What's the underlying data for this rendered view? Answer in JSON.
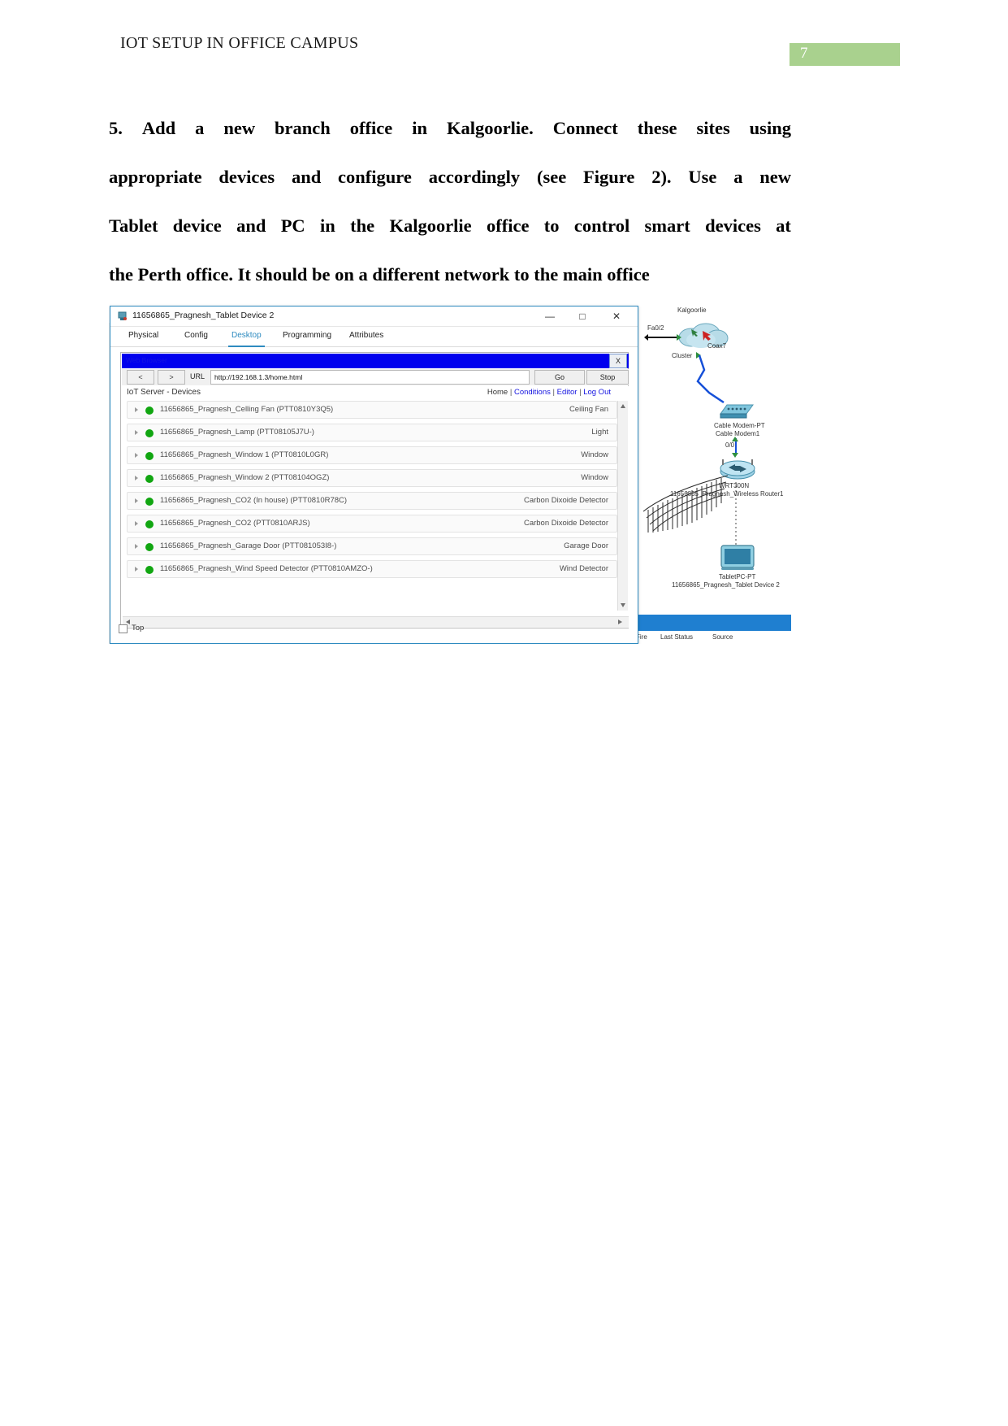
{
  "header": {
    "title": "IOT SETUP IN OFFICE CAMPUS",
    "page_number": "7",
    "page_number_bg": "#a9d18e"
  },
  "paragraph": {
    "lines": [
      [
        "5.",
        "Add",
        "a",
        "new",
        "branch",
        "office",
        "in",
        "Kalgoorlie.",
        "Connect",
        "these",
        "sites",
        "using"
      ],
      [
        "appropriate",
        "devices",
        "and",
        "configure",
        "accordingly",
        "(see",
        "Figure",
        "2).",
        "Use",
        "a",
        "new"
      ],
      [
        "Tablet",
        "device",
        "and",
        "PC",
        "in",
        "the",
        "Kalgoorlie",
        "office",
        "to",
        "control",
        "smart",
        "devices",
        "at"
      ]
    ],
    "last_line": "the Perth office.  It should be on a different network to the main office"
  },
  "tablet_window": {
    "title": "11656865_Pragnesh_Tablet Device 2",
    "icon": "packet-tracer-device-icon",
    "minimize": "—",
    "maximize": "□",
    "close": "✕",
    "tabs": [
      {
        "label": "Physical",
        "active": false
      },
      {
        "label": "Config",
        "active": false
      },
      {
        "label": "Desktop",
        "active": true
      },
      {
        "label": "Programming",
        "active": false
      },
      {
        "label": "Attributes",
        "active": false
      }
    ],
    "active_tab_color": "#2e8bc0"
  },
  "browser": {
    "title": "Web Browser",
    "title_bg": "#0000ee",
    "close_label": "X",
    "back_label": "<",
    "forward_label": ">",
    "url_label": "URL",
    "url_value": "http://192.168.1.3/home.html",
    "go_label": "Go",
    "stop_label": "Stop"
  },
  "page": {
    "heading": "IoT Server - Devices",
    "links": [
      {
        "label": "Home",
        "is_link": false
      },
      {
        "label": "Conditions",
        "is_link": true
      },
      {
        "label": "Editor",
        "is_link": true
      },
      {
        "label": "Log Out",
        "is_link": true
      }
    ],
    "link_separator": "|",
    "devices": [
      {
        "name": "11656865_Pragnesh_Celling Fan (PTT0810Y3Q5)",
        "type": "Ceiling Fan",
        "status": "on"
      },
      {
        "name": "11656865_Pragnesh_Lamp (PTT08105J7U-)",
        "type": "Light",
        "status": "on"
      },
      {
        "name": "11656865_Pragnesh_Window 1 (PTT0810L0GR)",
        "type": "Window",
        "status": "on"
      },
      {
        "name": "11656865_Pragnesh_Window 2 (PTT08104OGZ)",
        "type": "Window",
        "status": "on"
      },
      {
        "name": "11656865_Pragnesh_CO2 (In house) (PTT0810R78C)",
        "type": "Carbon Dixoide Detector",
        "status": "on"
      },
      {
        "name": "11656865_Pragnesh_CO2 (PTT0810ARJS)",
        "type": "Carbon Dixoide Detector",
        "status": "on"
      },
      {
        "name": "11656865_Pragnesh_Garage Door (PTT081053I8-)",
        "type": "Garage Door",
        "status": "on"
      },
      {
        "name": "11656865_Pragnesh_Wind Speed Detector (PTT0810AMZO-)",
        "type": "Wind Detector",
        "status": "on"
      }
    ],
    "status_dot_color": "#11a611",
    "top_checkbox_label": "Top",
    "top_checkbox_checked": false
  },
  "topology": {
    "site_label": "Kalgoorlie",
    "interface_label": "Fa0/2",
    "coax_label": "Coax7",
    "cluster_label": "Cluster",
    "modem_label_1": "Cable Modem-PT",
    "modem_label_2": "Cable Modem1",
    "modem_port": "0/0",
    "router_label_1": "WRT300N",
    "router_label_2": "11656865_Pragnesh_Wireless Router1",
    "tablet_label_1": "TabletPC-PT",
    "tablet_label_2": "11656865_Pragnesh_Tablet Device 2"
  },
  "pt_status_bar": {
    "bg": "#1f7fd0",
    "columns": [
      "Fire",
      "Last Status",
      "Source"
    ]
  }
}
